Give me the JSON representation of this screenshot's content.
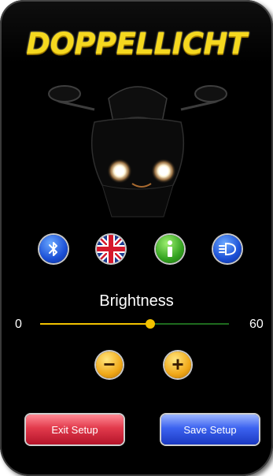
{
  "app": {
    "logo_text": "DOPPELLICHT"
  },
  "icons": [
    {
      "name": "bluetooth-icon",
      "label": "Bluetooth"
    },
    {
      "name": "uk-flag-icon",
      "label": "Language"
    },
    {
      "name": "info-icon",
      "label": "Info"
    },
    {
      "name": "headlight-icon",
      "label": "Headlight"
    }
  ],
  "brightness": {
    "title": "Brightness",
    "min_label": "0",
    "max_label": "60",
    "value": 35,
    "max": 60
  },
  "stepper": {
    "decrease_symbol": "−",
    "increase_symbol": "+"
  },
  "actions": {
    "exit_label": "Exit Setup",
    "save_label": "Save Setup"
  },
  "colors": {
    "logo": "#f5d81f",
    "slider_active": "#f2c200",
    "slider_inactive": "#1e6b1e",
    "exit_button": "#e23a4c",
    "save_button": "#3c63f0"
  }
}
